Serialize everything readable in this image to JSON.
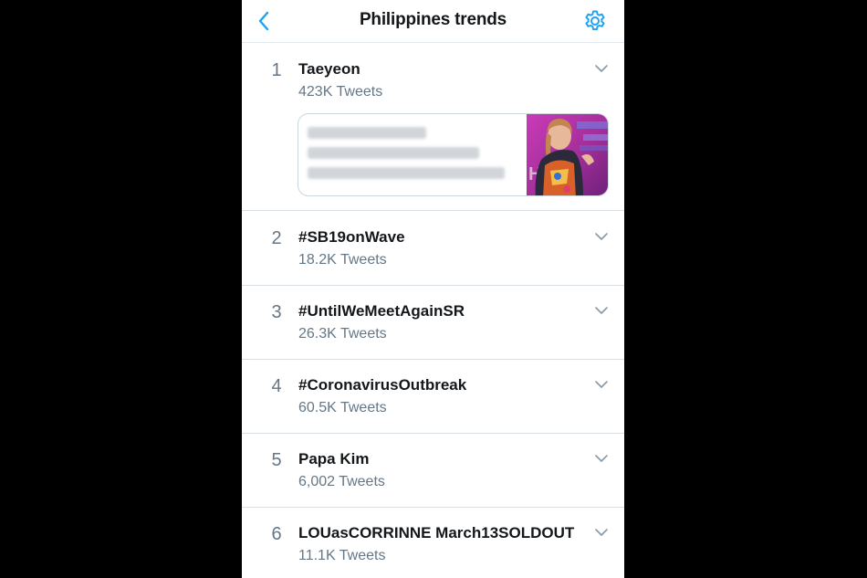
{
  "header": {
    "title": "Philippines trends",
    "accent_color": "#1DA1F2",
    "back_icon": "chevron-left-icon",
    "settings_icon": "gear-icon"
  },
  "trends": [
    {
      "rank": "1",
      "name": "Taeyeon",
      "count": "423K Tweets"
    },
    {
      "rank": "2",
      "name": "#SB19onWave",
      "count": "18.2K Tweets"
    },
    {
      "rank": "3",
      "name": "#UntilWeMeetAgainSR",
      "count": "26.3K Tweets"
    },
    {
      "rank": "4",
      "name": "#CoronavirusOutbreak",
      "count": "60.5K Tweets"
    },
    {
      "rank": "5",
      "name": "Papa Kim",
      "count": "6,002 Tweets"
    },
    {
      "rank": "6",
      "name": "LOUasCORRINNE March13SOLDOUT",
      "count": "11.1K Tweets"
    }
  ],
  "colors": {
    "text_primary": "#14171A",
    "text_secondary": "#657786",
    "divider": "#D8DFE4",
    "background": "#FFFFFF"
  }
}
